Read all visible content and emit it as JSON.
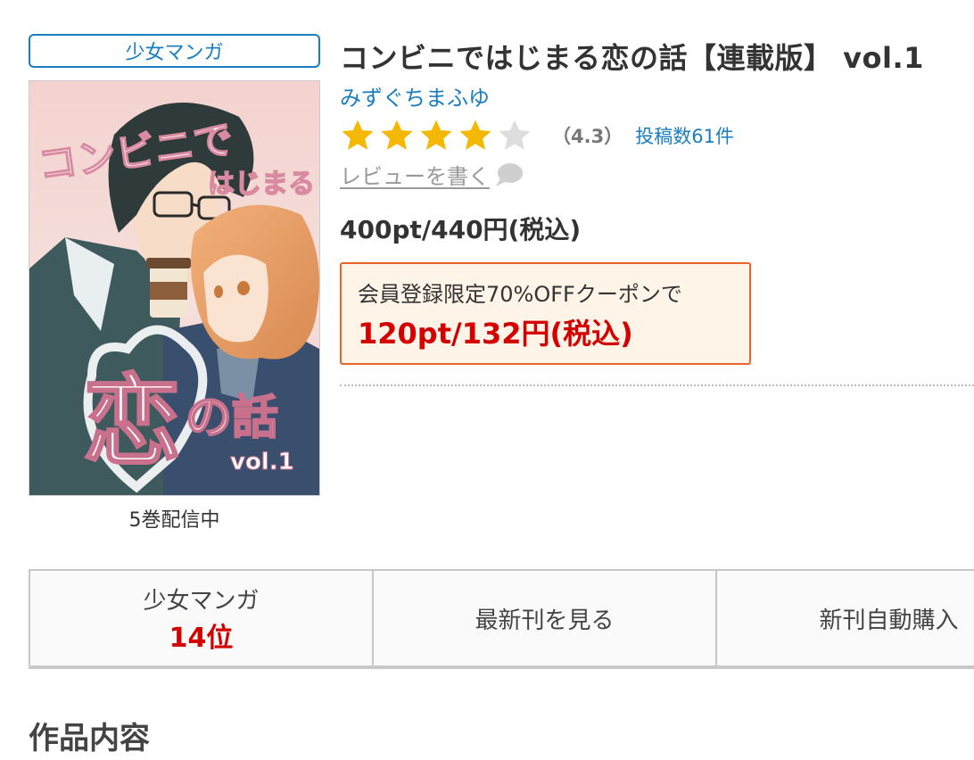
{
  "product": {
    "genre": "少女マンガ",
    "title": "コンビニではじまる恋の話【連載版】 vol.1",
    "author": "みずぐちまふゆ",
    "volumes_status": "5巻配信中",
    "cover": {
      "title_upper_1": "コンビニで",
      "title_upper_2": "はじまる",
      "title_kanji": "恋",
      "title_suffix": "の話",
      "volume_text": "vol.1"
    }
  },
  "rating": {
    "stars": 4.3,
    "value_text": "（4.3）",
    "review_count_text": "投稿数61件",
    "write_review_label": "レビューを書く",
    "star_color": "#f5b800"
  },
  "price": {
    "regular": "400pt/440円(税込)"
  },
  "coupon": {
    "label": "会員登録限定70%OFFクーポンで",
    "price": "120pt/132円(税込)",
    "border_color": "#e8642a",
    "price_color": "#d40000"
  },
  "actions": {
    "rank_genre": "少女マンガ",
    "rank_value": "14位",
    "latest_label": "最新刊を見る",
    "auto_purchase_label": "新刊自動購入"
  },
  "section": {
    "title": "作品内容"
  },
  "colors": {
    "accent_blue": "#1a7dc0",
    "text_dark": "#333333"
  }
}
